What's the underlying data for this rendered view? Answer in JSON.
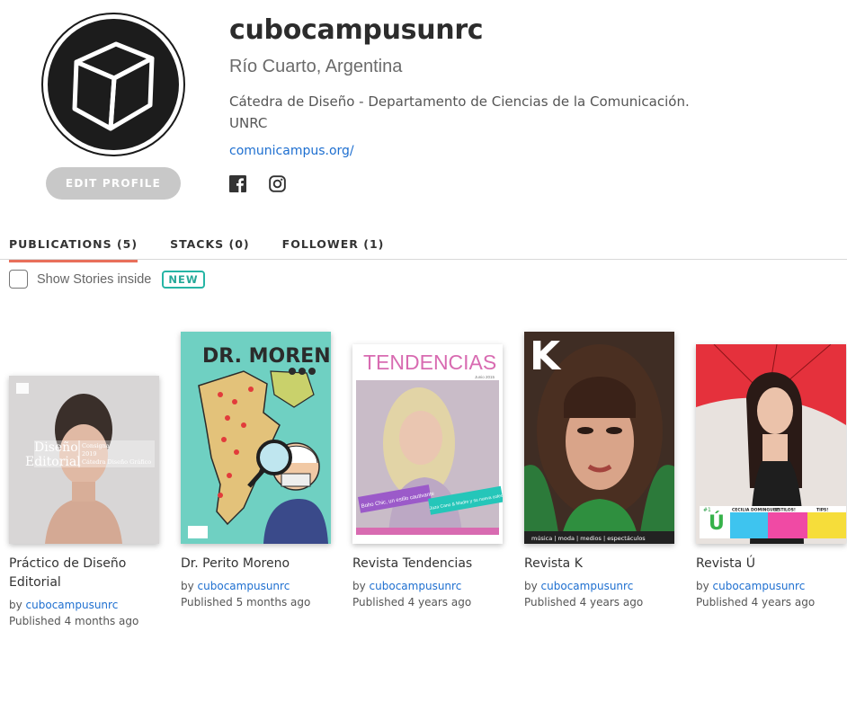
{
  "profile": {
    "username": "cubocampusunrc",
    "location": "Río Cuarto, Argentina",
    "bio": "Cátedra de Diseño - Departamento de Ciencias de la Comunicación. UNRC",
    "website": "comunicampus.org/",
    "edit_button": "EDIT PROFILE",
    "avatar_icon": "cube-icon",
    "social_icons": [
      "facebook-icon",
      "instagram-icon"
    ]
  },
  "tabs": [
    {
      "label": "PUBLICATIONS (5)",
      "active": true
    },
    {
      "label": "STACKS (0)",
      "active": false
    },
    {
      "label": "FOLLOWER (1)",
      "active": false
    }
  ],
  "stories_toggle": {
    "label": "Show Stories inside",
    "badge": "NEW",
    "checked": false
  },
  "publications": [
    {
      "title": "Práctico de Diseño Editorial",
      "by_prefix": "by",
      "author": "cubocampusunrc",
      "published": "Published 4 months ago",
      "cover": {
        "line1": "Diseño",
        "line2": "Editorial",
        "side1": "Consigna",
        "side2": "2019",
        "side3": "Cátedra Diseño Gráfico"
      }
    },
    {
      "title": "Dr. Perito Moreno",
      "by_prefix": "by",
      "author": "cubocampusunrc",
      "published": "Published 5 months ago",
      "cover": {
        "masthead": "DR. MORENO"
      }
    },
    {
      "title": "Revista Tendencias",
      "by_prefix": "by",
      "author": "cubocampusunrc",
      "published": "Published 4 years ago",
      "cover": {
        "masthead": "TENDENCIAS",
        "date": "Junio 2015",
        "tag1": "Boho Chic, un estilo cautivante",
        "tag2": "Jaza Cano & Madre y su nueva colección"
      }
    },
    {
      "title": "Revista K",
      "by_prefix": "by",
      "author": "cubocampusunrc",
      "published": "Published 4 years ago",
      "cover": {
        "masthead": "K",
        "footer": "música | moda | medios | espectáculos"
      }
    },
    {
      "title": "Revista Ú",
      "by_prefix": "by",
      "author": "cubocampusunrc",
      "published": "Published 4 years ago",
      "cover": {
        "masthead": "Ú",
        "box1": "CECILIA DOMINGUEZ",
        "box2": "ESTILOS!",
        "box3": "TIPS!",
        "issue": "#1"
      }
    }
  ],
  "colors": {
    "accent_tab": "#e86f5a",
    "link": "#1e6fd0",
    "badge": "#26b5a5"
  }
}
